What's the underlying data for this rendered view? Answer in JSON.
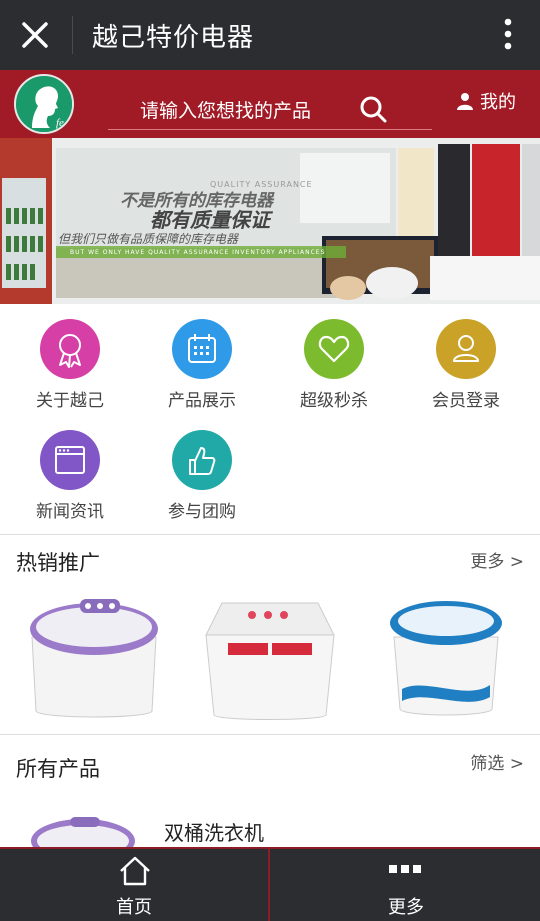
{
  "window": {
    "title": "越己特价电器"
  },
  "header": {
    "search_placeholder": "请输入您想找的产品",
    "mine_label": "我的"
  },
  "banner": {
    "small_en": "QUALITY ASSURANCE",
    "headline1": "不是所有的库存电器",
    "headline2": "都有质量保证",
    "sub": "但我们只做有品质保障的库存电器",
    "sub_en": "BUT WE ONLY HAVE QUALITY ASSURANCE INVENTORY APPLIANCES"
  },
  "menu": [
    {
      "label": "关于越己",
      "color": "#d63fa6",
      "icon": "award-ribbon-icon"
    },
    {
      "label": "产品展示",
      "color": "#2f9be8",
      "icon": "calendar-icon"
    },
    {
      "label": "超级秒杀",
      "color": "#7dbb2e",
      "icon": "heart-icon"
    },
    {
      "label": "会员登录",
      "color": "#c9a227",
      "icon": "user-icon"
    },
    {
      "label": "新闻资讯",
      "color": "#8156c6",
      "icon": "browser-window-icon"
    },
    {
      "label": "参与团购",
      "color": "#20a9a7",
      "icon": "thumbs-up-icon"
    }
  ],
  "hot": {
    "title": "热销推广",
    "more": "更多 >"
  },
  "all": {
    "title": "所有产品",
    "filter": "筛选 >",
    "first_item": "双桶洗衣机"
  },
  "bottom": {
    "home": "首页",
    "more": "更多"
  }
}
